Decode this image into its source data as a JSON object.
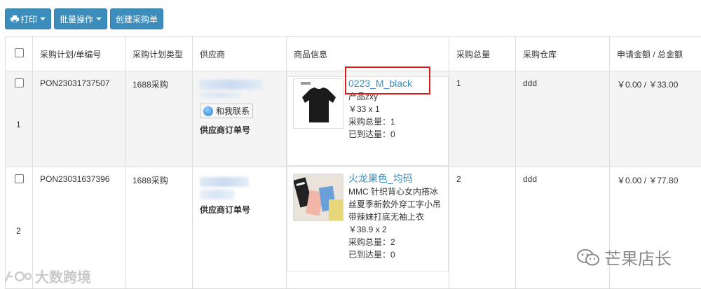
{
  "toolbar": {
    "print_label": "打印",
    "batch_label": "批量操作",
    "create_label": "创建采购单"
  },
  "table": {
    "headers": [
      "采购计划/单编号",
      "采购计划类型",
      "供应商",
      "商品信息",
      "采购总量",
      "采购仓库",
      "申请金额 / 总金额"
    ],
    "rows": [
      {
        "index": "1",
        "plan_no": "PON23031737507",
        "plan_type": "1688采购",
        "contact_label": "和我联系",
        "supplier_order_label": "供应商订单号",
        "goods_title": "0223_M_black",
        "goods_lines": [
          "产品zxy",
          "￥33 x 1",
          "采购总量：1",
          "已到达量：0"
        ],
        "total_qty": "1",
        "warehouse": "ddd",
        "amount": "￥0.00 / ￥33.00"
      },
      {
        "index": "2",
        "plan_no": "PON23031637396",
        "plan_type": "1688采购",
        "supplier_order_label": "供应商订单号",
        "goods_title": "火龙果色_均码",
        "goods_lines": [
          "MMC 针织背心女内搭冰",
          "丝夏季新款外穿工字小吊",
          "带辣妹打底无袖上衣",
          "￥38.9 x 2",
          "采购总量：2",
          "已到达量：0"
        ],
        "total_qty": "2",
        "warehouse": "ddd",
        "amount": "￥0.00 / ￥77.80"
      }
    ]
  },
  "watermarks": {
    "left": "大数跨境",
    "right": "芒果店长"
  },
  "colors": {
    "button": "#3c8dbc",
    "link": "#3c8dbc",
    "highlight": "#e01a1a"
  }
}
